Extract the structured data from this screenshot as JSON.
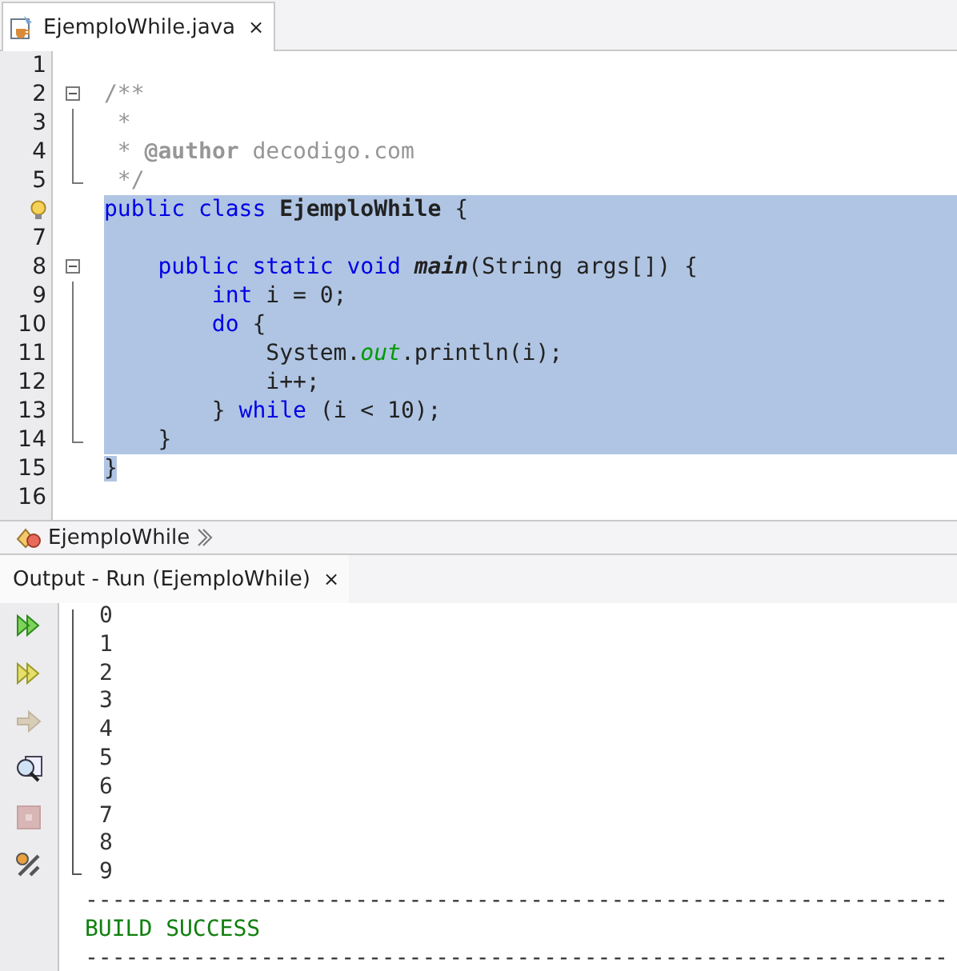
{
  "editor_tabs": [
    {
      "label": "EjemploWhile.java",
      "close": "×",
      "selected": true
    }
  ],
  "code_lines": [
    {
      "number": "1",
      "hint": false,
      "fold_start": false,
      "fold_end": false,
      "selected": false
    },
    {
      "number": "2",
      "hint": false,
      "fold_start": true,
      "fold_end": false,
      "selected": false,
      "segments": [
        {
          "kind": "comment",
          "text": "/**"
        }
      ]
    },
    {
      "number": "3",
      "hint": false,
      "fold_start": false,
      "fold_end": false,
      "selected": false,
      "segments": [
        {
          "kind": "comment",
          "text": " *"
        }
      ]
    },
    {
      "number": "4",
      "hint": false,
      "fold_start": false,
      "fold_end": false,
      "selected": false,
      "segments": [
        {
          "kind": "comment",
          "text": " * "
        },
        {
          "kind": "doctag",
          "text": "@author"
        },
        {
          "kind": "comment",
          "text": " decodigo.com"
        }
      ]
    },
    {
      "number": "5",
      "hint": false,
      "fold_start": false,
      "fold_end": true,
      "selected": false,
      "segments": [
        {
          "kind": "comment",
          "text": " */"
        }
      ]
    },
    {
      "hint": true,
      "fold_start": false,
      "fold_end": false,
      "selected": true,
      "segments": [
        {
          "kind": "keyword",
          "text": "public class "
        },
        {
          "kind": "bold",
          "text": "EjemploWhile"
        },
        {
          "kind": "plain",
          "text": " {"
        }
      ]
    },
    {
      "number": "7",
      "hint": false,
      "fold_start": false,
      "fold_end": false,
      "selected": true
    },
    {
      "number": "8",
      "hint": false,
      "fold_start": true,
      "fold_end": false,
      "selected": true,
      "segments": [
        {
          "kind": "keyword",
          "text": "    public static void "
        },
        {
          "kind": "method",
          "text": "main"
        },
        {
          "kind": "plain",
          "text": "(String args[]) {"
        }
      ]
    },
    {
      "number": "9",
      "hint": false,
      "fold_start": false,
      "fold_end": false,
      "selected": true,
      "segments": [
        {
          "kind": "keyword",
          "text": "        int"
        },
        {
          "kind": "plain",
          "text": " i = 0;"
        }
      ]
    },
    {
      "number": "10",
      "hint": false,
      "fold_start": false,
      "fold_end": false,
      "selected": true,
      "segments": [
        {
          "kind": "keyword",
          "text": "        do"
        },
        {
          "kind": "plain",
          "text": " {"
        }
      ]
    },
    {
      "number": "11",
      "hint": false,
      "fold_start": false,
      "fold_end": false,
      "selected": true,
      "segments": [
        {
          "kind": "plain",
          "text": "            System."
        },
        {
          "kind": "field",
          "text": "out"
        },
        {
          "kind": "plain",
          "text": ".println(i);"
        }
      ]
    },
    {
      "number": "12",
      "hint": false,
      "fold_start": false,
      "fold_end": false,
      "selected": true,
      "segments": [
        {
          "kind": "plain",
          "text": "            i++;"
        }
      ]
    },
    {
      "number": "13",
      "hint": false,
      "fold_start": false,
      "fold_end": false,
      "selected": true,
      "segments": [
        {
          "kind": "plain",
          "text": "        } "
        },
        {
          "kind": "keyword",
          "text": "while"
        },
        {
          "kind": "plain",
          "text": " (i < 10);"
        }
      ]
    },
    {
      "number": "14",
      "hint": false,
      "fold_start": false,
      "fold_end": true,
      "selected": true,
      "segments": [
        {
          "kind": "plain",
          "text": "    }"
        }
      ]
    },
    {
      "number": "15",
      "hint": false,
      "fold_start": false,
      "fold_end": false,
      "selected": false,
      "text_selected": true,
      "segments": [
        {
          "kind": "plain",
          "text": "}"
        }
      ]
    },
    {
      "number": "16",
      "hint": false,
      "fold_start": false,
      "fold_end": false,
      "selected": false
    }
  ],
  "breadcrumb": {
    "label": "EjemploWhile"
  },
  "output_tabs": [
    {
      "label": "Output - Run (EjemploWhile)",
      "close": "×",
      "selected": true
    }
  ],
  "output_toolbar": [
    {
      "kind": "rerun",
      "disabled": false
    },
    {
      "kind": "rerun-options",
      "disabled": false
    },
    {
      "kind": "next",
      "disabled": true
    },
    {
      "kind": "inspect",
      "disabled": false
    },
    {
      "kind": "stop",
      "disabled": true
    },
    {
      "kind": "settings",
      "disabled": false
    }
  ],
  "output_lines": [
    {
      "kind": "plain",
      "text": "0"
    },
    {
      "kind": "plain",
      "text": "1"
    },
    {
      "kind": "plain",
      "text": "2"
    },
    {
      "kind": "plain",
      "text": "3"
    },
    {
      "kind": "plain",
      "text": "4"
    },
    {
      "kind": "plain",
      "text": "5"
    },
    {
      "kind": "plain",
      "text": "6"
    },
    {
      "kind": "plain",
      "text": "7"
    },
    {
      "kind": "plain",
      "text": "8"
    },
    {
      "kind": "plain",
      "text": "9"
    },
    {
      "kind": "rule",
      "text": "----------------------------------------------------------------"
    },
    {
      "kind": "success",
      "text": "BUILD SUCCESS"
    },
    {
      "kind": "rule",
      "text": "----------------------------------------------------------------"
    }
  ]
}
